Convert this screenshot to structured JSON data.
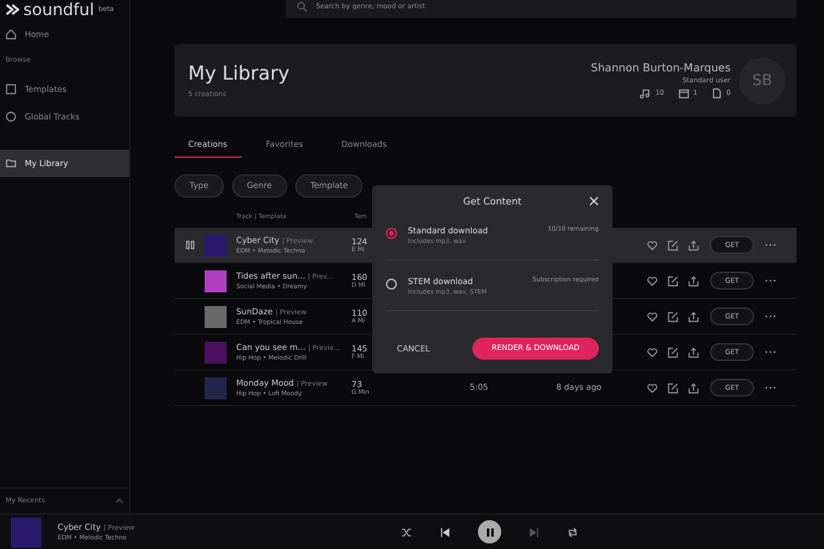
{
  "brand": {
    "name": "soundful",
    "badge": "beta"
  },
  "search": {
    "placeholder": "Search by genre, mood or artist"
  },
  "sidebar": {
    "items": [
      {
        "label": "Home",
        "kind": "home",
        "selected": false
      },
      {
        "label": "Browse",
        "kind": "section",
        "selected": false
      },
      {
        "label": "Templates",
        "kind": "templates",
        "selected": false
      },
      {
        "label": "Global Tracks",
        "kind": "global",
        "selected": false
      },
      {
        "label": "My Library",
        "kind": "library",
        "selected": true
      }
    ],
    "recents": {
      "label": "My Recents",
      "expanded": true
    }
  },
  "header": {
    "title": "My Library",
    "subtitle": "5 creations",
    "user": {
      "name": "Shannon Burton-Marques",
      "role": "Standard user",
      "initials": "SB"
    },
    "stats": [
      {
        "kind": "tracks",
        "value": "10"
      },
      {
        "kind": "calendar",
        "value": "1"
      },
      {
        "kind": "files",
        "value": "0"
      }
    ]
  },
  "tabs": [
    {
      "label": "Creations",
      "selected": true
    },
    {
      "label": "Favorites",
      "selected": false
    },
    {
      "label": "Downloads",
      "selected": false
    }
  ],
  "filters": [
    "Type",
    "Genre",
    "Template"
  ],
  "table": {
    "columns": [
      "Track | Template",
      "Tem"
    ],
    "rows": [
      {
        "title": "Cyber City",
        "tag": "| Preview",
        "genre": "EDM • Melodic Techno",
        "tempo": "124",
        "key": "E Mi",
        "color": "#2a1a6e",
        "selected": true,
        "action": "GET"
      },
      {
        "title": "Tides after sun...",
        "tag": "| Prev...",
        "genre": "Social Media • Dreamy",
        "tempo": "160",
        "key": "D Mi",
        "color": "#b040c0",
        "selected": false,
        "action": "GET"
      },
      {
        "title": "SunDaze",
        "tag": "| Preview",
        "genre": "EDM • Tropical House",
        "tempo": "110",
        "key": "A Mi",
        "color": "#6a6a6a",
        "selected": false,
        "action": "GET"
      },
      {
        "title": "Can you see m...",
        "tag": "| Previe...",
        "genre": "Hip Hop • Melodic Drill",
        "tempo": "145",
        "key": "F Mi",
        "color": "#4a1060",
        "selected": false,
        "action": "GET"
      },
      {
        "title": "Monday Mood",
        "tag": "| Preview",
        "genre": "Hip Hop • Lofi Moody",
        "tempo": "73",
        "key": "G Min",
        "color": "#23264a",
        "selected": false,
        "duration": "5:05",
        "date": "8 days ago",
        "action": "GET"
      }
    ]
  },
  "modal": {
    "title": "Get Content",
    "options": [
      {
        "label": "Standard download",
        "detail": "Includes mp3, wav",
        "status": "10/10 remaining",
        "selected": true
      },
      {
        "label": "STEM download",
        "detail": "Includes mp3, wav, STEM",
        "status": "Subscription required",
        "selected": false
      }
    ],
    "cancel": "CANCEL",
    "confirm": "RENDER & DOWNLOAD"
  },
  "player": {
    "title": "Cyber City",
    "tag": "| Preview",
    "genre": "EDM • Melodic Techno",
    "playing": true
  }
}
